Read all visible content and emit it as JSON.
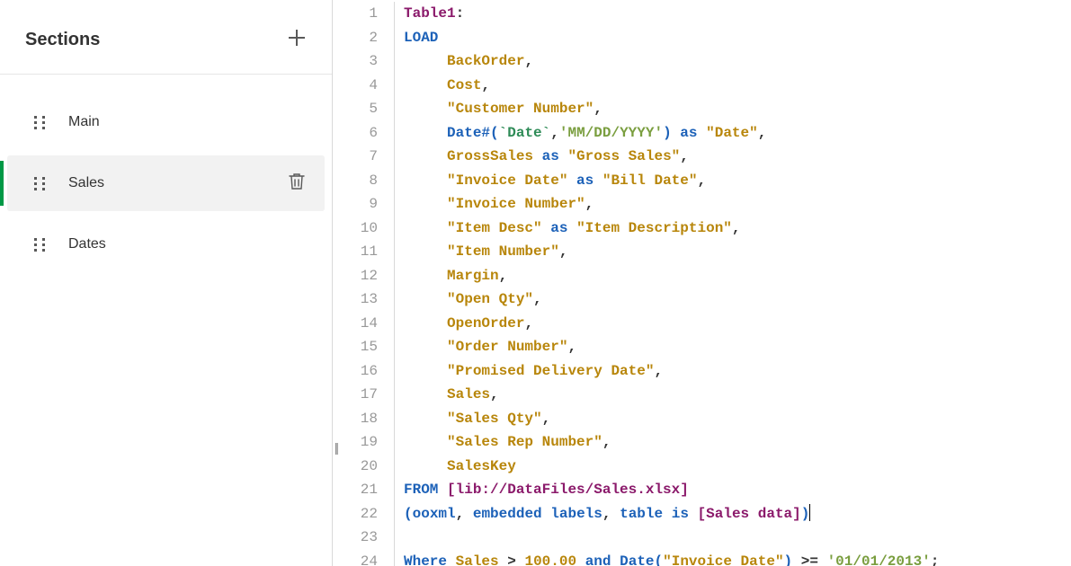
{
  "sidebar": {
    "title": "Sections",
    "items": [
      {
        "label": "Main",
        "selected": false
      },
      {
        "label": "Sales",
        "selected": true
      },
      {
        "label": "Dates",
        "selected": false
      }
    ]
  },
  "editor": {
    "lines": [
      {
        "n": 1,
        "tokens": [
          [
            "Table1",
            "table"
          ],
          [
            ":",
            "punc"
          ]
        ]
      },
      {
        "n": 2,
        "tokens": [
          [
            "LOAD",
            "kw"
          ]
        ]
      },
      {
        "n": 3,
        "tokens": [
          [
            "     ",
            ""
          ],
          [
            "BackOrder",
            "ident"
          ],
          [
            ",",
            "punc"
          ]
        ]
      },
      {
        "n": 4,
        "tokens": [
          [
            "     ",
            ""
          ],
          [
            "Cost",
            "ident"
          ],
          [
            ",",
            "punc"
          ]
        ]
      },
      {
        "n": 5,
        "tokens": [
          [
            "     ",
            ""
          ],
          [
            "\"Customer Number\"",
            "str"
          ],
          [
            ",",
            "punc"
          ]
        ]
      },
      {
        "n": 6,
        "tokens": [
          [
            "     ",
            ""
          ],
          [
            "Date#",
            "kw"
          ],
          [
            "(",
            "paren"
          ],
          [
            "`Date`",
            "backtick"
          ],
          [
            ",",
            "punc"
          ],
          [
            "'MM/DD/YYYY'",
            "sqstr"
          ],
          [
            ")",
            "paren"
          ],
          [
            " ",
            ""
          ],
          [
            "as",
            "kw"
          ],
          [
            " ",
            ""
          ],
          [
            "\"Date\"",
            "str"
          ],
          [
            ",",
            "punc"
          ]
        ]
      },
      {
        "n": 7,
        "tokens": [
          [
            "     ",
            ""
          ],
          [
            "GrossSales",
            "ident"
          ],
          [
            " ",
            ""
          ],
          [
            "as",
            "kw"
          ],
          [
            " ",
            ""
          ],
          [
            "\"Gross Sales\"",
            "str"
          ],
          [
            ",",
            "punc"
          ]
        ]
      },
      {
        "n": 8,
        "tokens": [
          [
            "     ",
            ""
          ],
          [
            "\"Invoice Date\"",
            "str"
          ],
          [
            " ",
            ""
          ],
          [
            "as",
            "kw"
          ],
          [
            " ",
            ""
          ],
          [
            "\"Bill Date\"",
            "str"
          ],
          [
            ",",
            "punc"
          ]
        ]
      },
      {
        "n": 9,
        "tokens": [
          [
            "     ",
            ""
          ],
          [
            "\"Invoice Number\"",
            "str"
          ],
          [
            ",",
            "punc"
          ]
        ]
      },
      {
        "n": 10,
        "tokens": [
          [
            "     ",
            ""
          ],
          [
            "\"Item Desc\"",
            "str"
          ],
          [
            " ",
            ""
          ],
          [
            "as",
            "kw"
          ],
          [
            " ",
            ""
          ],
          [
            "\"Item Description\"",
            "str"
          ],
          [
            ",",
            "punc"
          ]
        ]
      },
      {
        "n": 11,
        "tokens": [
          [
            "     ",
            ""
          ],
          [
            "\"Item Number\"",
            "str"
          ],
          [
            ",",
            "punc"
          ]
        ]
      },
      {
        "n": 12,
        "tokens": [
          [
            "     ",
            ""
          ],
          [
            "Margin",
            "ident"
          ],
          [
            ",",
            "punc"
          ]
        ]
      },
      {
        "n": 13,
        "tokens": [
          [
            "     ",
            ""
          ],
          [
            "\"Open Qty\"",
            "str"
          ],
          [
            ",",
            "punc"
          ]
        ]
      },
      {
        "n": 14,
        "tokens": [
          [
            "     ",
            ""
          ],
          [
            "OpenOrder",
            "ident"
          ],
          [
            ",",
            "punc"
          ]
        ]
      },
      {
        "n": 15,
        "tokens": [
          [
            "     ",
            ""
          ],
          [
            "\"Order Number\"",
            "str"
          ],
          [
            ",",
            "punc"
          ]
        ]
      },
      {
        "n": 16,
        "tokens": [
          [
            "     ",
            ""
          ],
          [
            "\"Promised Delivery Date\"",
            "str"
          ],
          [
            ",",
            "punc"
          ]
        ]
      },
      {
        "n": 17,
        "tokens": [
          [
            "     ",
            ""
          ],
          [
            "Sales",
            "ident"
          ],
          [
            ",",
            "punc"
          ]
        ]
      },
      {
        "n": 18,
        "tokens": [
          [
            "     ",
            ""
          ],
          [
            "\"Sales Qty\"",
            "str"
          ],
          [
            ",",
            "punc"
          ]
        ]
      },
      {
        "n": 19,
        "tokens": [
          [
            "     ",
            ""
          ],
          [
            "\"Sales Rep Number\"",
            "str"
          ],
          [
            ",",
            "punc"
          ]
        ]
      },
      {
        "n": 20,
        "tokens": [
          [
            "     ",
            ""
          ],
          [
            "SalesKey",
            "ident"
          ]
        ]
      },
      {
        "n": 21,
        "tokens": [
          [
            "FROM",
            "kw"
          ],
          [
            " ",
            ""
          ],
          [
            "[lib://DataFiles/Sales.xlsx]",
            "bracket"
          ]
        ]
      },
      {
        "n": 22,
        "tokens": [
          [
            "(",
            "paren"
          ],
          [
            "ooxml",
            "kw"
          ],
          [
            ",",
            "punc"
          ],
          [
            " ",
            ""
          ],
          [
            "embedded",
            "kw"
          ],
          [
            " ",
            ""
          ],
          [
            "labels",
            "kw"
          ],
          [
            ",",
            "punc"
          ],
          [
            " ",
            ""
          ],
          [
            "table",
            "kw"
          ],
          [
            " ",
            ""
          ],
          [
            "is",
            "kw"
          ],
          [
            " ",
            ""
          ],
          [
            "[Sales data]",
            "bracket"
          ],
          [
            ")",
            "paren"
          ]
        ],
        "cursor": true
      },
      {
        "n": 23,
        "tokens": []
      },
      {
        "n": 24,
        "tokens": [
          [
            "Where",
            "kw"
          ],
          [
            " ",
            ""
          ],
          [
            "Sales",
            "ident"
          ],
          [
            " ",
            ""
          ],
          [
            ">",
            "punc"
          ],
          [
            " ",
            ""
          ],
          [
            "100.00",
            "num"
          ],
          [
            " ",
            ""
          ],
          [
            "and",
            "kw"
          ],
          [
            " ",
            ""
          ],
          [
            "Date",
            "kw"
          ],
          [
            "(",
            "paren"
          ],
          [
            "\"Invoice Date\"",
            "str"
          ],
          [
            ")",
            "paren"
          ],
          [
            " ",
            ""
          ],
          [
            ">=",
            "punc"
          ],
          [
            " ",
            ""
          ],
          [
            "'01/01/2013'",
            "sqstr"
          ],
          [
            ";",
            "punc"
          ]
        ]
      }
    ]
  }
}
